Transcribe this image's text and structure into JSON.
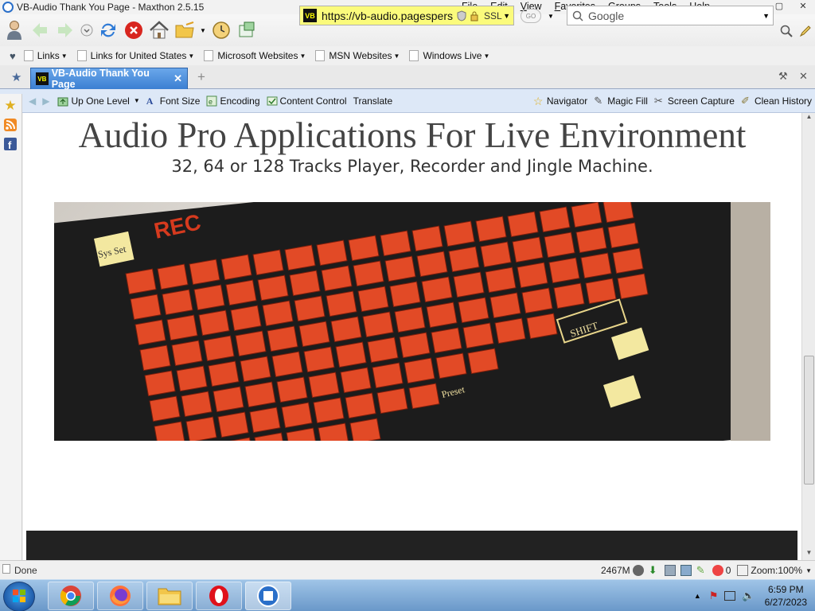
{
  "window": {
    "title": "VB-Audio Thank You Page - Maxthon 2.5.15",
    "menu": [
      "File",
      "Edit",
      "View",
      "Favorites",
      "Groups",
      "Tools",
      "Help"
    ]
  },
  "navbar": {
    "url": "https://vb-audio.pagespers",
    "ssl_label": "SSL",
    "go_label": "GO",
    "search_placeholder": "Google"
  },
  "favorites": {
    "items": [
      "Links",
      "Links for United States",
      "Microsoft Websites",
      "MSN Websites",
      "Windows Live"
    ]
  },
  "tabs": [
    {
      "label": "VB-Audio Thank You Page",
      "icon_text": "VB"
    }
  ],
  "toolbar2": {
    "left": [
      "Up One Level",
      "Font Size",
      "Encoding",
      "Content Control",
      "Translate"
    ],
    "right": [
      "Navigator",
      "Magic Fill",
      "Screen Capture",
      "Clean History"
    ]
  },
  "content": {
    "heading": "Audio Pro Applications For Live Environment",
    "subheading": "32, 64 or 128 Tracks Player, Recorder and Jingle Machine.",
    "panel": {
      "rec_label": "REC",
      "sys_label": "Sys Set",
      "shift_label": "SHIFT",
      "preset_label": "Preset"
    }
  },
  "statusbar": {
    "status": "Done",
    "memory": "2467M",
    "count": "0",
    "zoom": "Zoom:100%"
  },
  "taskbar": {
    "time": "6:59 PM",
    "date": "6/27/2023"
  },
  "colors": {
    "address_bg": "#fbfb7c",
    "tab_active": "#3b7fd2",
    "toolbar2_bg": "#dde8f7",
    "pad_red": "#e24a26",
    "footer_bg": "#222222"
  }
}
